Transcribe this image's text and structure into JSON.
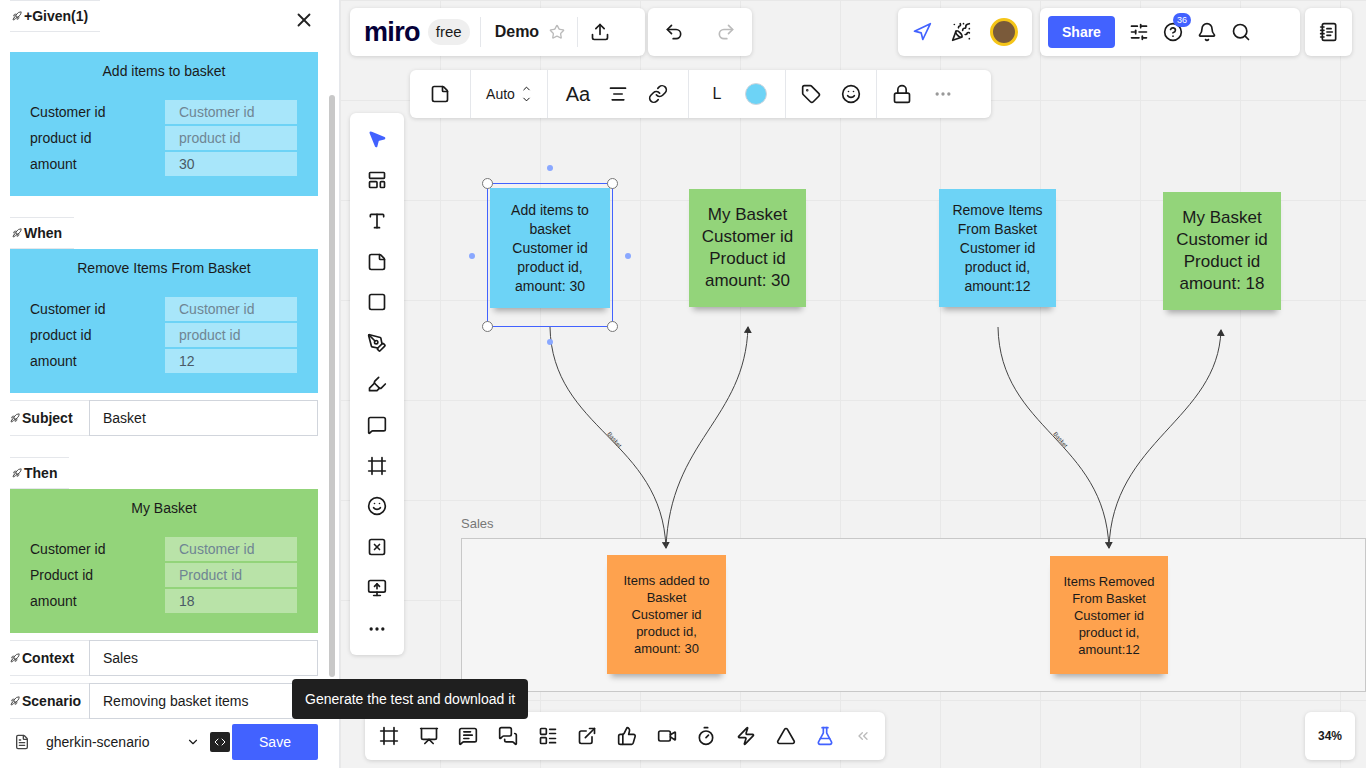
{
  "panel": {
    "items": [
      {
        "kind": "heading",
        "label": "+Given(1)"
      },
      {
        "kind": "card",
        "title": "Add items to basket",
        "color": "#6dd3f6",
        "fields": [
          {
            "label": "Customer id",
            "value": "Customer id",
            "placeholder": true
          },
          {
            "label": "product id",
            "value": "product id",
            "placeholder": true
          },
          {
            "label": "amount",
            "value": "30",
            "placeholder": false
          }
        ]
      },
      {
        "kind": "heading",
        "label": "When"
      },
      {
        "kind": "card",
        "title": "Remove Items From Basket",
        "color": "#6dd3f6",
        "fields": [
          {
            "label": "Customer id",
            "value": "Customer id",
            "placeholder": true
          },
          {
            "label": "product id",
            "value": "product id",
            "placeholder": true
          },
          {
            "label": "amount",
            "value": "12",
            "placeholder": false
          }
        ]
      },
      {
        "kind": "field",
        "label": "Subject",
        "value": "Basket"
      },
      {
        "kind": "heading",
        "label": "Then"
      },
      {
        "kind": "card",
        "title": "My Basket",
        "color": "#93d47a",
        "fields": [
          {
            "label": "Customer id",
            "value": "Customer id",
            "placeholder": true
          },
          {
            "label": "Product id",
            "value": "Product id",
            "placeholder": true
          },
          {
            "label": "amount",
            "value": "18",
            "placeholder": false
          }
        ]
      },
      {
        "kind": "field",
        "label": "Context",
        "value": "Sales"
      },
      {
        "kind": "field",
        "label": "Scenario",
        "value": "Removing basket items"
      }
    ],
    "format": "gherkin-scenario",
    "save": "Save"
  },
  "tooltip": "Generate the test and download it",
  "topbar": {
    "logo": "miro",
    "plan": "free",
    "board": "Demo",
    "share": "Share",
    "help_badge": "36"
  },
  "context_toolbar": {
    "size": "Auto",
    "font": "Aa",
    "line": "L",
    "color": "#6dd3f6"
  },
  "zoom": "34%",
  "frame": {
    "label": "Sales"
  },
  "stickies": [
    {
      "kind": "command",
      "color": "#6dd3f6",
      "selected": true,
      "lines": [
        "Add items to basket",
        "Customer id",
        "product id,",
        "amount: 30"
      ]
    },
    {
      "kind": "read-model",
      "color": "#93d47a",
      "selected": false,
      "lines": [
        "My Basket",
        "Customer id",
        "Product id",
        "amount: 30"
      ]
    },
    {
      "kind": "command",
      "color": "#6dd3f6",
      "selected": false,
      "lines": [
        "Remove Items From Basket",
        "Customer id",
        "product id,",
        "amount:12"
      ]
    },
    {
      "kind": "read-model",
      "color": "#93d47a",
      "selected": false,
      "lines": [
        "My Basket",
        "Customer id",
        "Product id",
        "amount: 18"
      ]
    },
    {
      "kind": "event",
      "color": "#fea24e",
      "selected": false,
      "lines": [
        "Items added to Basket",
        "Customer id",
        "product id,",
        "amount: 30"
      ]
    },
    {
      "kind": "event",
      "color": "#fea24e",
      "selected": false,
      "lines": [
        "Items Removed From Basket",
        "Customer id",
        "product id,",
        "amount:12"
      ]
    }
  ],
  "connectors": [
    {
      "label": "Basket"
    },
    {
      "label": "Basket"
    }
  ]
}
